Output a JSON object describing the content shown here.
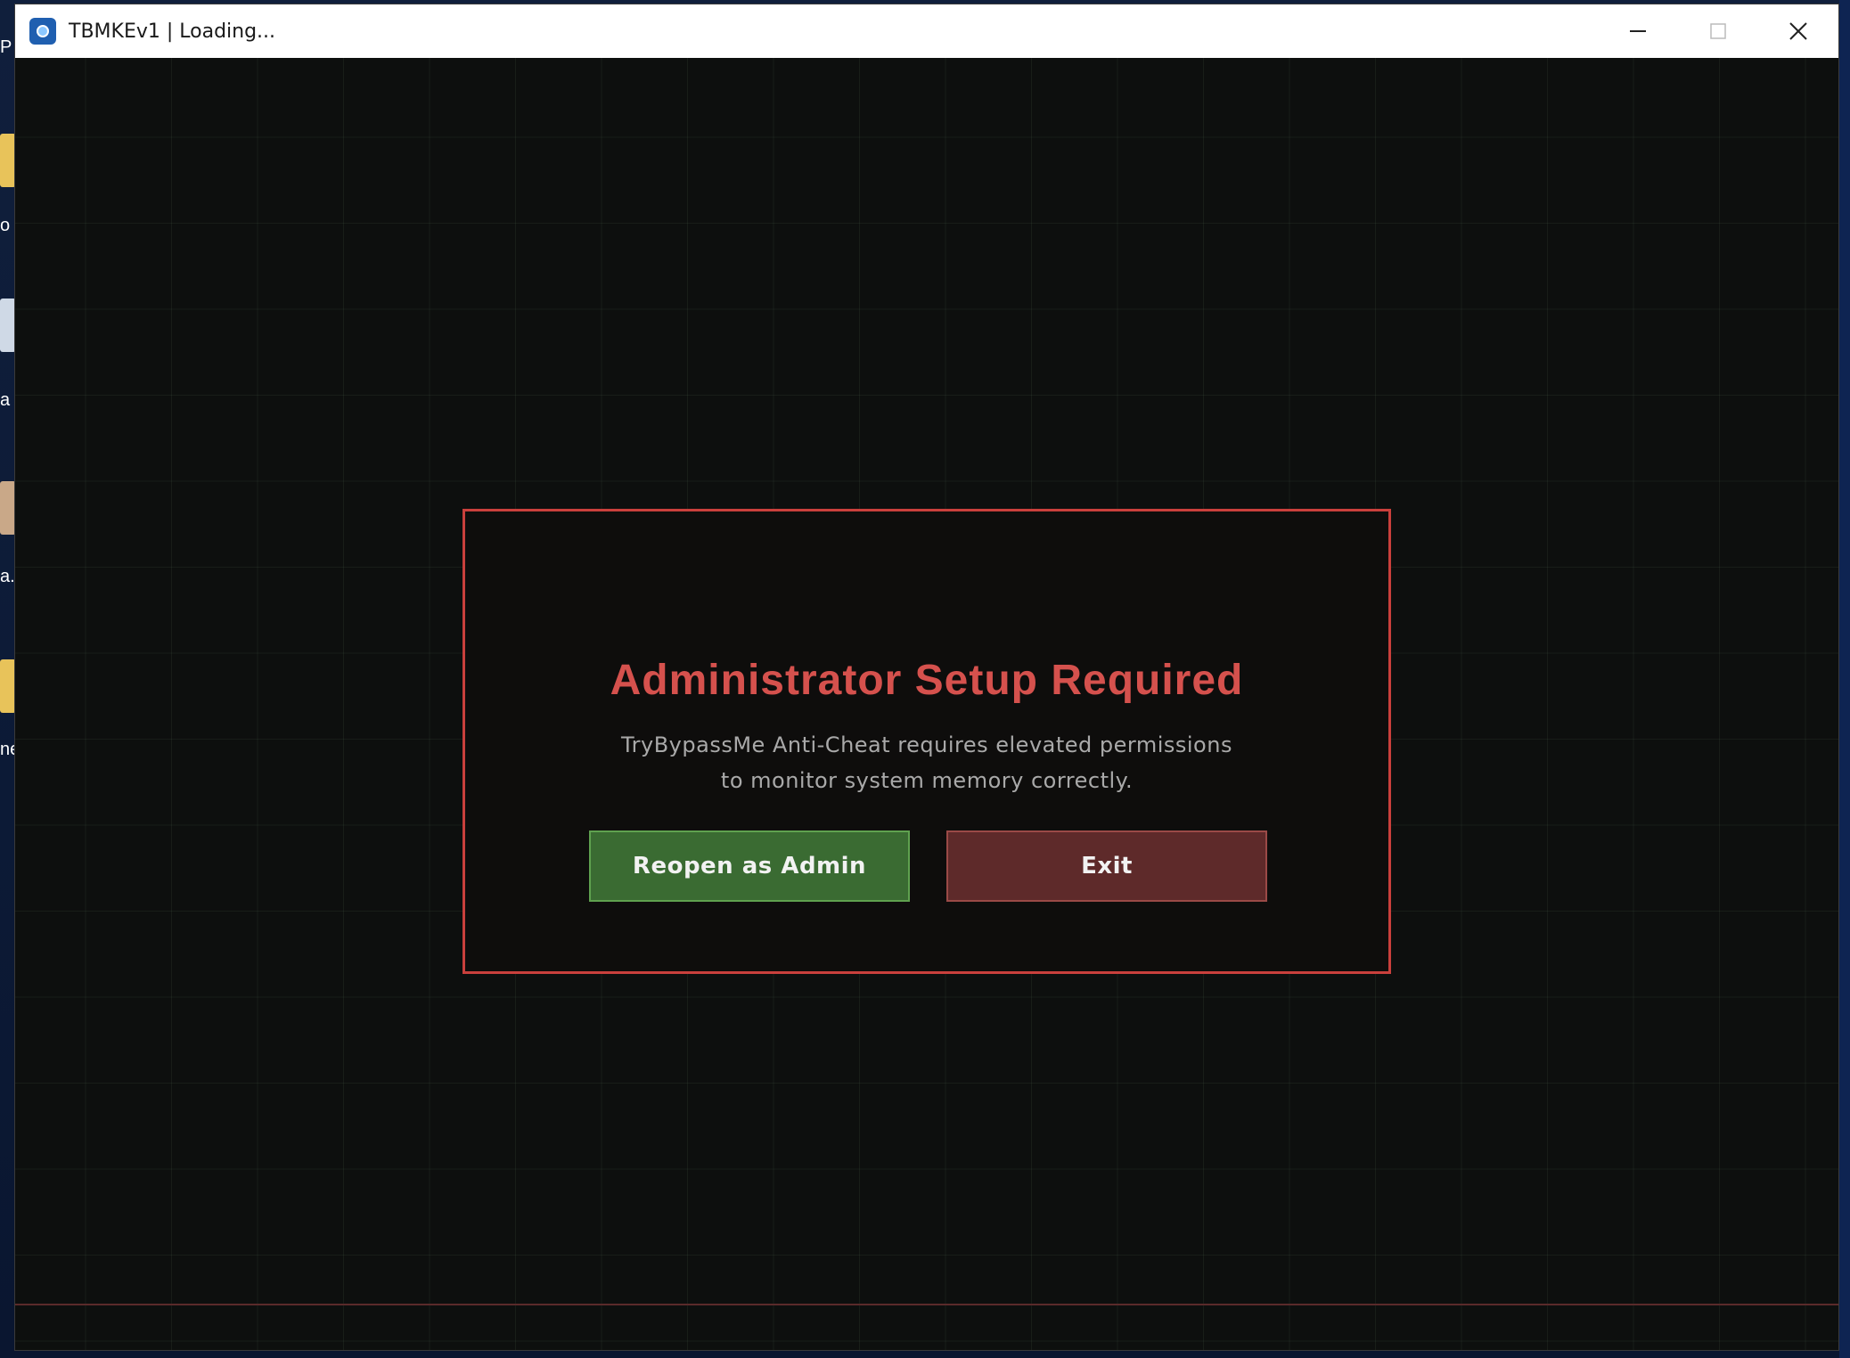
{
  "window": {
    "title": "TBMKEv1 | Loading..."
  },
  "desktop": {
    "labels": [
      "P",
      "o",
      "a",
      "a.",
      "ne"
    ]
  },
  "modal": {
    "title": "Administrator Setup Required",
    "message_line1": "TryBypassMe Anti-Cheat requires elevated permissions",
    "message_line2": "to monitor system memory correctly.",
    "primary_button": "Reopen as Admin",
    "secondary_button": "Exit"
  },
  "colors": {
    "accent_red": "#d5514d",
    "modal_border": "#c9403c",
    "admin_button": "#3a6b32",
    "exit_button": "#5e2a2a",
    "background": "#0d0f0e"
  },
  "icons": {
    "app": "app-icon",
    "minimize": "minimize-icon",
    "maximize": "maximize-icon",
    "close": "close-icon"
  }
}
